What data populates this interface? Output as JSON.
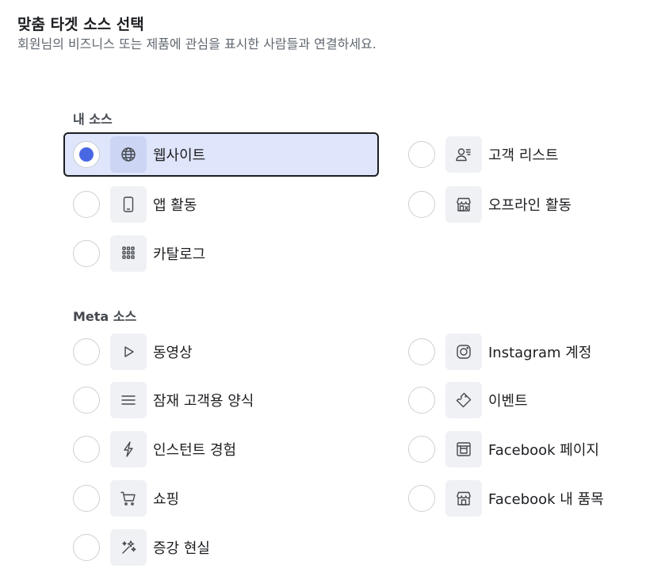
{
  "header": {
    "title": "맞춤 타겟 소스 선택",
    "subtitle": "회원님의 비즈니스 또는 제품에 관심을 표시한 사람들과 연결하세요."
  },
  "my_sources": {
    "label": "내 소스",
    "items": [
      {
        "label": "웹사이트",
        "icon": "globe-icon",
        "selected": true
      },
      {
        "label": "고객 리스트",
        "icon": "customer-list-icon",
        "selected": false
      },
      {
        "label": "앱 활동",
        "icon": "phone-icon",
        "selected": false
      },
      {
        "label": "오프라인 활동",
        "icon": "store-icon",
        "selected": false
      },
      {
        "label": "카탈로그",
        "icon": "grid-icon",
        "selected": false
      }
    ]
  },
  "meta_sources": {
    "label": "Meta 소스",
    "items": [
      {
        "label": "동영상",
        "icon": "play-icon",
        "selected": false
      },
      {
        "label": "Instagram 계정",
        "icon": "instagram-icon",
        "selected": false
      },
      {
        "label": "잠재 고객용 양식",
        "icon": "form-lines-icon",
        "selected": false
      },
      {
        "label": "이벤트",
        "icon": "ticket-icon",
        "selected": false
      },
      {
        "label": "인스턴트 경험",
        "icon": "lightning-icon",
        "selected": false
      },
      {
        "label": "Facebook 페이지",
        "icon": "page-icon",
        "selected": false
      },
      {
        "label": "쇼핑",
        "icon": "cart-icon",
        "selected": false
      },
      {
        "label": "Facebook 내 품목",
        "icon": "shop-icon",
        "selected": false
      },
      {
        "label": "증강 현실",
        "icon": "sparkle-icon",
        "selected": false
      }
    ]
  },
  "colors": {
    "selected_bg": "#dfe5fb",
    "radio_accent": "#4a67e3",
    "icon_bg": "#f0f1f4"
  }
}
